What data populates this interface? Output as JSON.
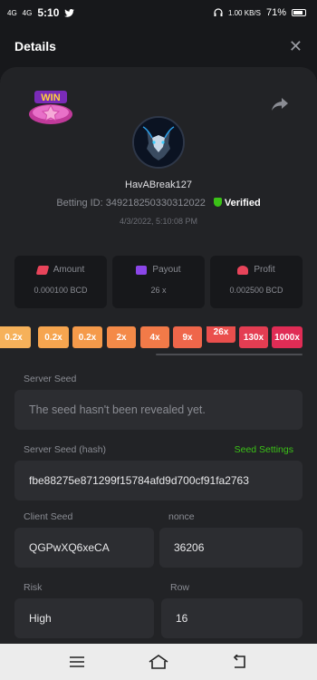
{
  "status_bar": {
    "time": "5:10",
    "network_left": "4G",
    "network_right": "4G",
    "speed": "1.00 KB/S",
    "battery": "71%"
  },
  "header": {
    "title": "Details"
  },
  "bet": {
    "badge": "WIN",
    "username": "HavABreak127",
    "betting_id_label": "Betting ID:",
    "betting_id": "349218250330312022",
    "verified": "Verified",
    "date": "4/3/2022, 5:10:08 PM"
  },
  "stats": [
    {
      "label": "Amount",
      "value": "0.000100 BCD",
      "icon": "amount-icon",
      "color": "#e8445a"
    },
    {
      "label": "Payout",
      "value": "26 x",
      "icon": "payout-icon",
      "color": "#8b46e8"
    },
    {
      "label": "Profit",
      "value": "0.002500 BCD",
      "icon": "profit-icon",
      "color": "#e8445a"
    }
  ],
  "multipliers": [
    {
      "label": "0.2x",
      "color": "#f6b15a"
    },
    {
      "label": "0.2x",
      "color": "#f6a54f"
    },
    {
      "label": "0.2x",
      "color": "#f59a4a"
    },
    {
      "label": "2x",
      "color": "#f48a48"
    },
    {
      "label": "4x",
      "color": "#f27a48"
    },
    {
      "label": "9x",
      "color": "#ef664a"
    },
    {
      "label": "26x",
      "color": "#ea4f4d"
    },
    {
      "label": "130x",
      "color": "#e43d52"
    },
    {
      "label": "1000x",
      "color": "#e02c55"
    }
  ],
  "fields": {
    "server_seed_label": "Server Seed",
    "server_seed_value": "The seed hasn't been revealed yet.",
    "server_seed_hash_label": "Server Seed (hash)",
    "seed_settings": "Seed Settings",
    "server_seed_hash_value": "fbe88275e871299f15784afd9d700cf91fa2763",
    "client_seed_label": "Client Seed",
    "client_seed_value": "QGPwXQ6xeCA",
    "nonce_label": "nonce",
    "nonce_value": "36206",
    "risk_label": "Risk",
    "risk_value": "High",
    "row_label": "Row",
    "row_value": "16"
  },
  "colors": {
    "accent_green": "#3bc117",
    "panel": "#222326",
    "background": "#17181b"
  }
}
